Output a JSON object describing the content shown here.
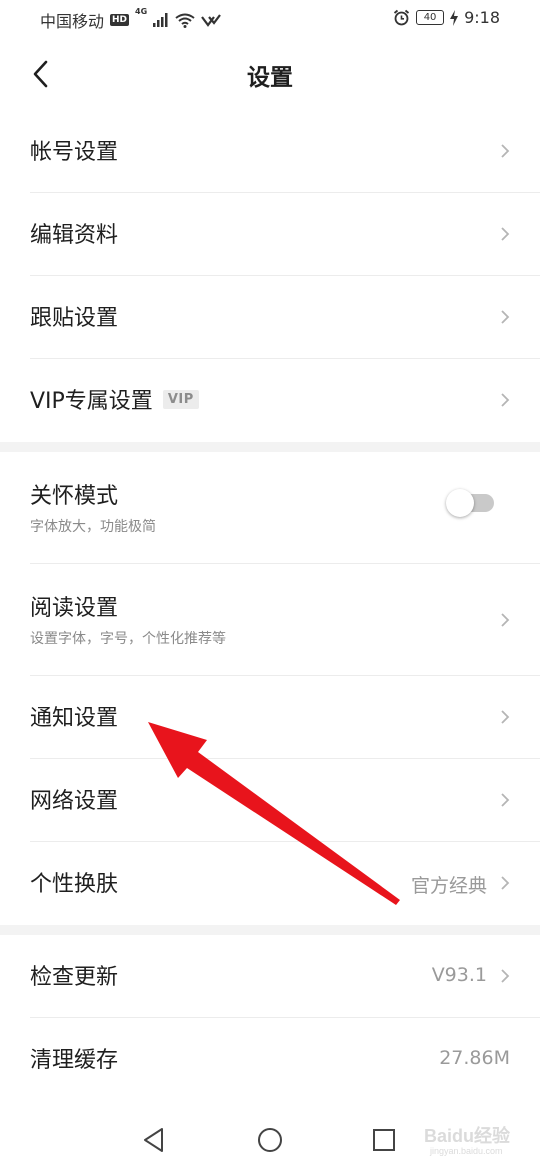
{
  "status_bar": {
    "carrier": "中国移动",
    "hd": "HD",
    "network": "4G",
    "battery": "40",
    "time": "9:18"
  },
  "header": {
    "title": "设置"
  },
  "sections": [
    {
      "items": [
        {
          "label": "帐号设置"
        },
        {
          "label": "编辑资料"
        },
        {
          "label": "跟贴设置"
        },
        {
          "label": "VIP专属设置",
          "badge": "VIP"
        }
      ]
    },
    {
      "items": [
        {
          "label": "关怀模式",
          "subtitle": "字体放大，功能极简",
          "toggle_on": false
        },
        {
          "label": "阅读设置",
          "subtitle": "设置字体，字号，个性化推荐等"
        },
        {
          "label": "通知设置"
        },
        {
          "label": "网络设置"
        },
        {
          "label": "个性换肤",
          "value": "官方经典"
        }
      ]
    },
    {
      "items": [
        {
          "label": "检查更新",
          "value": "V93.1"
        },
        {
          "label": "清理缓存",
          "value": "27.86M"
        }
      ]
    }
  ],
  "annotation": {
    "arrow_color": "#e8141c",
    "points_to": "通知设置"
  },
  "watermark": {
    "text": "Baidu经验",
    "sub": "jingyan.baidu.com"
  }
}
